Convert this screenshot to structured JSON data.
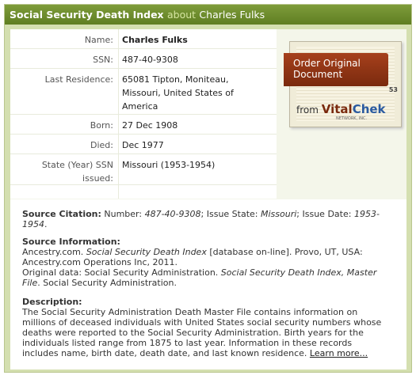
{
  "header": {
    "title": "Social Security Death Index",
    "about": "about",
    "person": "Charles Fulks"
  },
  "record": [
    {
      "label": "Name:",
      "value": "Charles Fulks"
    },
    {
      "label": "SSN:",
      "value": "487-40-9308"
    },
    {
      "label": "Last Residence:",
      "value_line1": "65081  Tipton, Moniteau,",
      "value_line2": "Missouri, United States of",
      "value_line3": "America"
    },
    {
      "label": "Born:",
      "value": "27 Dec 1908"
    },
    {
      "label": "Died:",
      "value": "Dec 1977"
    },
    {
      "label_line1": "State (Year) SSN",
      "label_line2": "issued:",
      "value": "Missouri (1953-1954)"
    }
  ],
  "ad": {
    "line1": "Order Original",
    "line2": "Document",
    "from": "from",
    "brand1": "Vital",
    "brand2": "Chek",
    "brand_sub": "NETWORK, INC.",
    "doc_number": "53"
  },
  "citation": {
    "heading": "Source Citation:",
    "number_label": "Number:",
    "number": "487-40-9308",
    "state_label": "; Issue State:",
    "state": "Missouri",
    "date_label": "; Issue Date:",
    "date": "1953-1954",
    "end": "."
  },
  "source_info": {
    "heading": "Source Information:",
    "l1a": "Ancestry.com.",
    "l1b": "Social Security Death Index",
    "l1c": "[database on-line]. Provo, UT, USA:",
    "l2": "Ancestry.com Operations Inc, 2011.",
    "l3a": "Original data: Social Security Administration.",
    "l3b": "Social Security Death Index, Master",
    "l4a": "File",
    "l4b": ". Social Security Administration."
  },
  "description": {
    "heading": "Description:",
    "lines": [
      "The Social Security Administration Death Master File contains information on",
      "millions of deceased individuals with United States social security numbers whose",
      "deaths were reported to the Social Security Administration. Birth years for the",
      "individuals listed range from 1875 to last year. Information in these records",
      "includes name, birth date, death date, and last known residence."
    ],
    "learn_more": "Learn more..."
  }
}
